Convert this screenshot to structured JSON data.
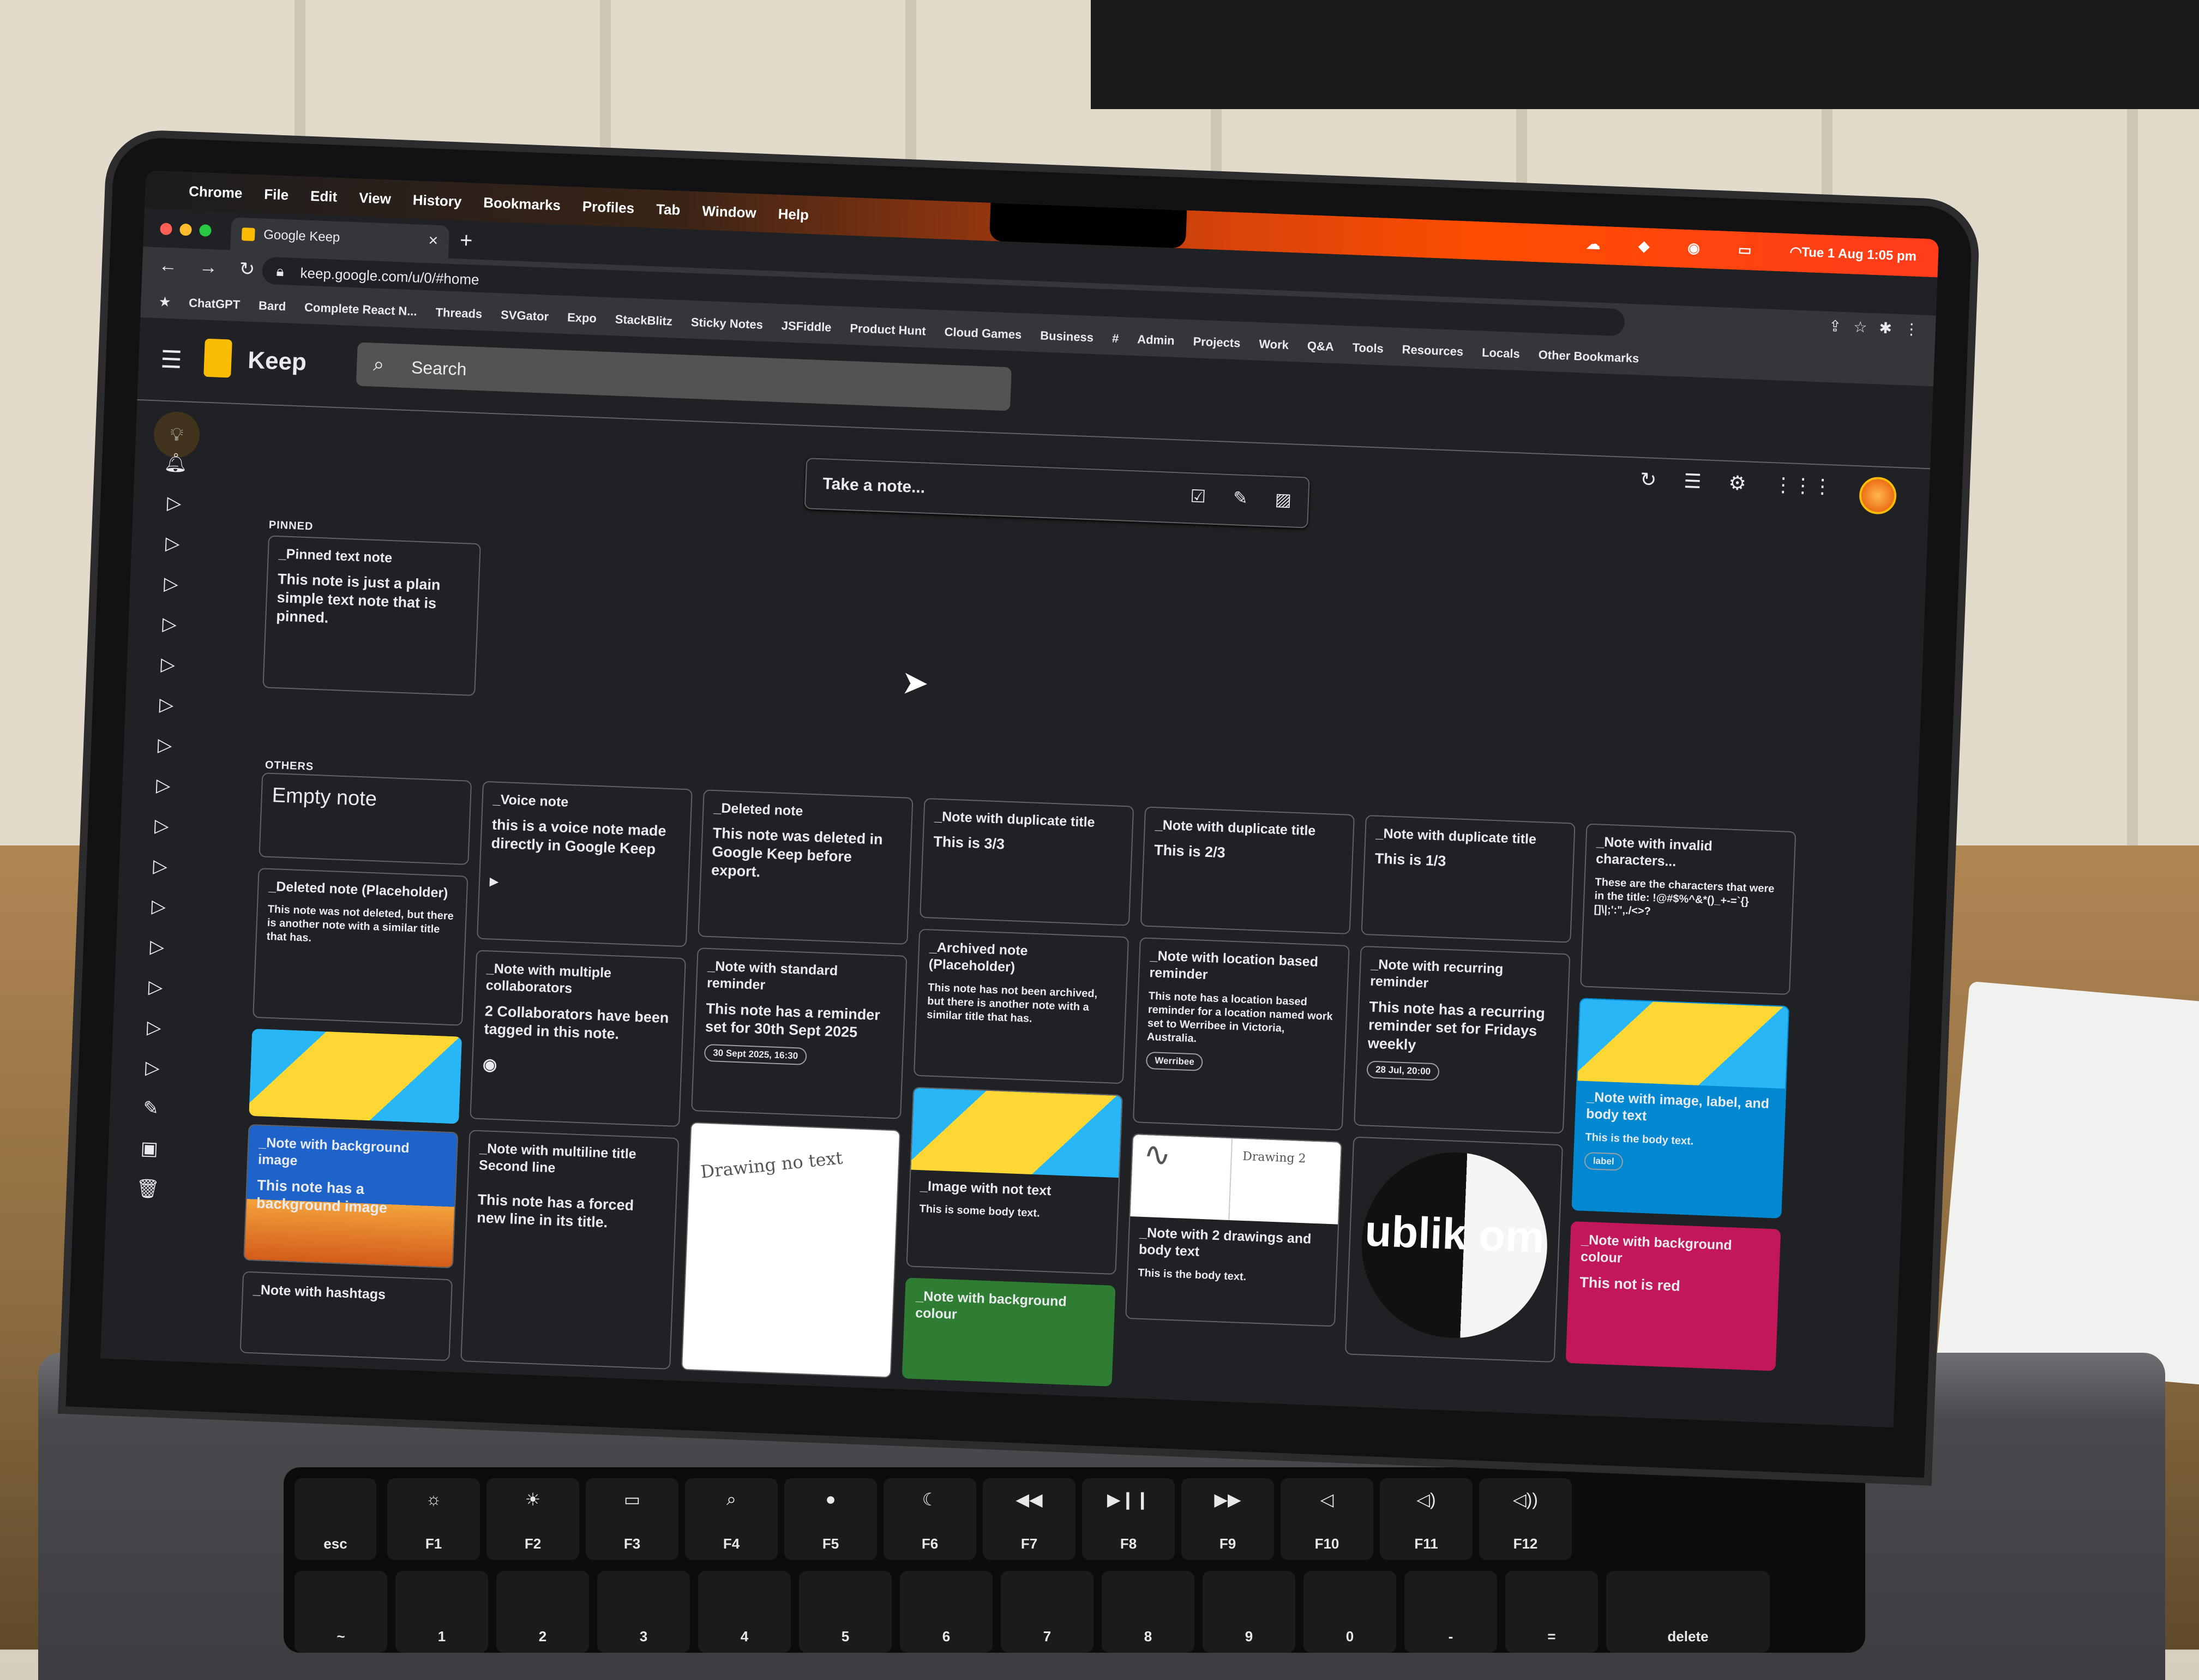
{
  "menubar": {
    "items": [
      "Chrome",
      "File",
      "Edit",
      "View",
      "History",
      "Bookmarks",
      "Profiles",
      "Tab",
      "Window",
      "Help"
    ],
    "clock": "Tue 1 Aug  1:05 pm"
  },
  "browser": {
    "tab_title": "Google Keep",
    "tab_close": "×",
    "new_tab": "+",
    "url": "keep.google.com/u/0/#home",
    "bookmarks": [
      "ChatGPT",
      "Bard",
      "Complete React N...",
      "Threads",
      "SVGator",
      "Expo",
      "StackBlitz",
      "Sticky Notes",
      "JSFiddle",
      "Product Hunt",
      "Cloud Games",
      "Business",
      "#",
      "Admin",
      "Projects",
      "Work",
      "Q&A",
      "Tools",
      "Resources",
      "Locals",
      "Other Bookmarks"
    ]
  },
  "keep": {
    "app_name": "Keep",
    "search_placeholder": "Search",
    "take_note_placeholder": "Take a note...",
    "pinned_label": "PINNED",
    "others_label": "OTHERS"
  },
  "notes": {
    "pinned": {
      "title": "_Pinned text note",
      "body": "This note is just a plain simple text note that is pinned."
    },
    "empty": {
      "body": "Empty note"
    },
    "deleted_placeholder": {
      "title": "_Deleted note (Placeholder)",
      "body": "This note was not deleted, but there is another note with a similar title that has."
    },
    "bg_image": {
      "title": "_Note with background image",
      "body": "This note has a background image"
    },
    "hashtags": {
      "title": "_Note with hashtags"
    },
    "voice": {
      "title": "_Voice note",
      "body": "this is a voice note made directly in Google Keep"
    },
    "collaborators": {
      "title": "_Note with multiple collaborators",
      "body": "2 Collaborators have been tagged in this note."
    },
    "multiline": {
      "title": "_Note with multiline title\nSecond line",
      "body": "This note has a forced new line in its title."
    },
    "deleted": {
      "title": "_Deleted note",
      "body": "This note was deleted in Google Keep before export."
    },
    "standard_reminder": {
      "title": "_Note with standard reminder",
      "body": "This note has a reminder set for 30th Sept 2025",
      "chip": "30 Sept 2025, 16:30"
    },
    "drawing_text": "Drawing no text",
    "dup3": {
      "title": "_Note with duplicate title",
      "body": "This is 3/3"
    },
    "archived": {
      "title": "_Archived note (Placeholder)",
      "body": "This note has not been archived, but there is another note with a similar title that has."
    },
    "image_no_text": {
      "title": "_Image with not text",
      "body": "This is some body text."
    },
    "bg_colour_green": {
      "title": "_Note with background colour"
    },
    "dup2": {
      "title": "_Note with duplicate title",
      "body": "This is 2/3"
    },
    "location": {
      "title": "_Note with location based reminder",
      "body": "This note has a location based reminder for a location named work set to Werribee in Victoria, Australia.",
      "chip": "Werribee"
    },
    "two_drawings": {
      "title": "_Note with 2 drawings and body text",
      "body": "This is the body text.",
      "drawing_label": "Drawing 2"
    },
    "dup1": {
      "title": "_Note with duplicate title",
      "body": "This is 1/3"
    },
    "recurring": {
      "title": "_Note with recurring reminder",
      "body": "This note has a recurring reminder set for Fridays weekly",
      "chip": "28 Jul, 20:00"
    },
    "logo_text": "ublik om",
    "invalid": {
      "title": "_Note with invalid characters...",
      "body": "These are the characters that were in the title: !@#$%^&*()_+-=`{}[]\\|;':\",./<>?"
    },
    "image_label": {
      "title": "_Note with image, label, and body text",
      "body": "This is the body text.",
      "chip": "label"
    },
    "bg_colour_red": {
      "title": "_Note with background colour",
      "body": "This not is red"
    }
  },
  "keyboard": {
    "fkeys": [
      "esc",
      "F1",
      "F2",
      "F3",
      "F4",
      "F5",
      "F6",
      "F7",
      "F8",
      "F9",
      "F10",
      "F11",
      "F12"
    ],
    "numbers": [
      "~",
      "1",
      "2",
      "3",
      "4",
      "5",
      "6",
      "7",
      "8",
      "9",
      "0",
      "-",
      "=",
      "delete"
    ]
  },
  "colors": {
    "keep_bg": "#202124",
    "keep_yellow": "#fbbc04",
    "red_note": "#c2185b",
    "green_note": "#2e7d32",
    "blue_note": "#0288d1"
  }
}
